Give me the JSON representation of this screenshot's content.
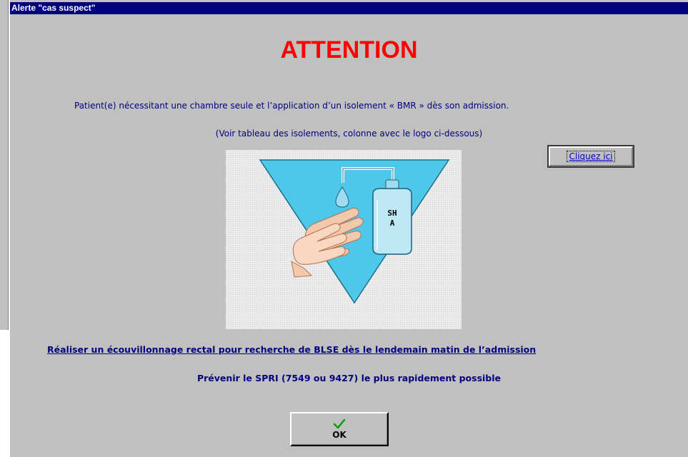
{
  "window": {
    "title": "Alerte \"cas suspect\""
  },
  "alert": {
    "heading": "ATTENTION",
    "message": "Patient(e) nécessitant une chambre seule et l’application d’un isolement « BMR » dès son admission.",
    "reference_note": "(Voir tableau des isolements, colonne avec le logo ci-dessous)",
    "logo_label": "SHA",
    "link_button_label": "Cliquez ici",
    "instruction_link": "Réaliser un écouvillonnage rectal pour recherche de BLSE dès le lendemain matin de l’admission",
    "notice": "Prévenir le SPRI (7549 ou 9427) le plus rapidement possible",
    "ok_label": "OK"
  },
  "icons": {
    "logo": "hand-hygiene-sha-icon",
    "ok": "green-checkmark-icon"
  },
  "colors": {
    "dialog_background": "#c0c0c0",
    "titlebar": "#000080",
    "heading": "#ff0000",
    "body_text": "#000080",
    "logo_triangle": "#4fc7e8",
    "ok_check": "#00a000"
  }
}
